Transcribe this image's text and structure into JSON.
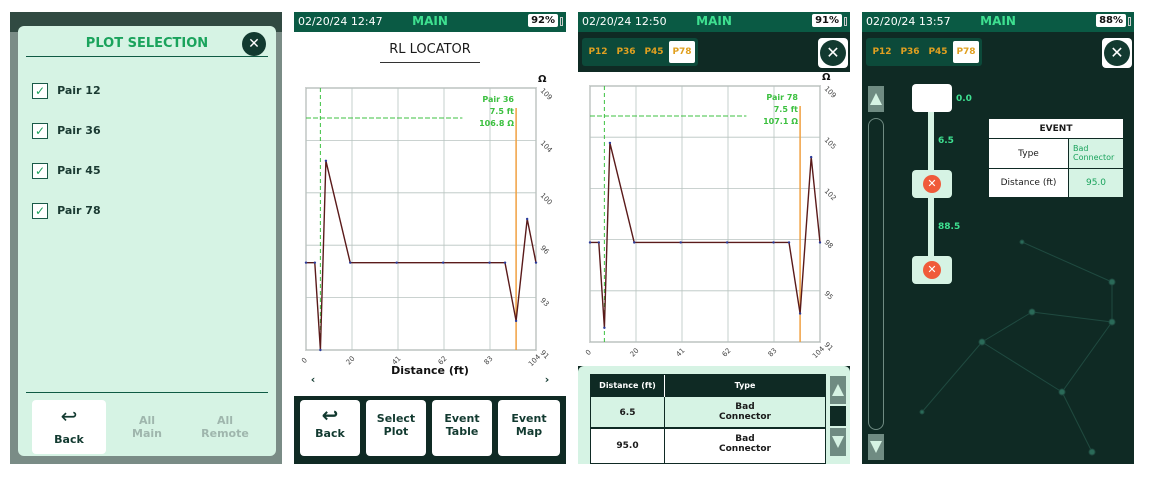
{
  "screen1": {
    "title": "PLOT SELECTION",
    "pairs": [
      "Pair 12",
      "Pair 36",
      "Pair 45",
      "Pair 78"
    ],
    "buttons": {
      "back": "Back",
      "all_main_1": "All",
      "all_main_2": "Main",
      "all_remote_1": "All",
      "all_remote_2": "Remote"
    }
  },
  "screen2": {
    "status": {
      "datetime": "02/20/24 12:47",
      "mode": "MAIN",
      "battery": "92%"
    },
    "title": "RL LOCATOR",
    "unit": "Ω",
    "annotation": [
      "Pair 36",
      "7.5 ft",
      "106.8 Ω"
    ],
    "x_label": "Distance (ft)",
    "buttons": {
      "back": "Back",
      "select_1": "Select",
      "select_2": "Plot",
      "event_table_1": "Event",
      "event_table_2": "Table",
      "event_map_1": "Event",
      "event_map_2": "Map"
    }
  },
  "screen3": {
    "status": {
      "datetime": "02/20/24 12:50",
      "mode": "MAIN",
      "battery": "91%"
    },
    "tabs": [
      "P12",
      "P36",
      "P45",
      "P78"
    ],
    "unit": "Ω",
    "annotation": [
      "Pair 78",
      "7.5 ft",
      "107.1 Ω"
    ],
    "table": {
      "headers": [
        "Distance (ft)",
        "Type"
      ],
      "rows": [
        {
          "distance": "6.5",
          "type_1": "Bad",
          "type_2": "Connector"
        },
        {
          "distance": "95.0",
          "type_1": "Bad",
          "type_2": "Connector"
        }
      ]
    }
  },
  "screen4": {
    "status": {
      "datetime": "02/20/24 13:57",
      "mode": "MAIN",
      "battery": "88%"
    },
    "tabs": [
      "P12",
      "P36",
      "P45",
      "P78"
    ],
    "map_labels": [
      "0.0",
      "6.5",
      "88.5"
    ],
    "event": {
      "title": "EVENT",
      "type_label": "Type",
      "type_value_1": "Bad",
      "type_value_2": "Connector",
      "distance_label": "Distance (ft)",
      "distance_value": "95.0"
    }
  },
  "chart_data": [
    {
      "type": "line",
      "xlabel": "Distance (ft)",
      "ylabel": "Ω",
      "x_ticks": [
        "0",
        "20",
        "41",
        "62",
        "83",
        "104"
      ],
      "y_ticks": [
        "109",
        "104",
        "100",
        "96",
        "93",
        "91"
      ],
      "xlim": [
        0,
        104
      ],
      "series": [
        {
          "name": "Pair 36",
          "x": [
            0,
            4,
            6.5,
            9,
            20,
            41,
            62,
            83,
            90,
            95,
            100,
            104
          ],
          "y": [
            97,
            97,
            91,
            104,
            97,
            97,
            97,
            97,
            97,
            93,
            100,
            97
          ]
        }
      ]
    },
    {
      "type": "line",
      "xlabel": "",
      "ylabel": "Ω",
      "x_ticks": [
        "0",
        "20",
        "41",
        "62",
        "83",
        "104"
      ],
      "y_ticks": [
        "109",
        "105",
        "102",
        "98",
        "95",
        "91"
      ],
      "xlim": [
        0,
        104
      ],
      "series": [
        {
          "name": "Pair 78",
          "x": [
            0,
            4,
            6.5,
            9,
            20,
            41,
            62,
            83,
            90,
            95,
            100,
            104
          ],
          "y": [
            98,
            98,
            92,
            105,
            98,
            98,
            98,
            98,
            98,
            93,
            104,
            98
          ]
        }
      ]
    }
  ]
}
